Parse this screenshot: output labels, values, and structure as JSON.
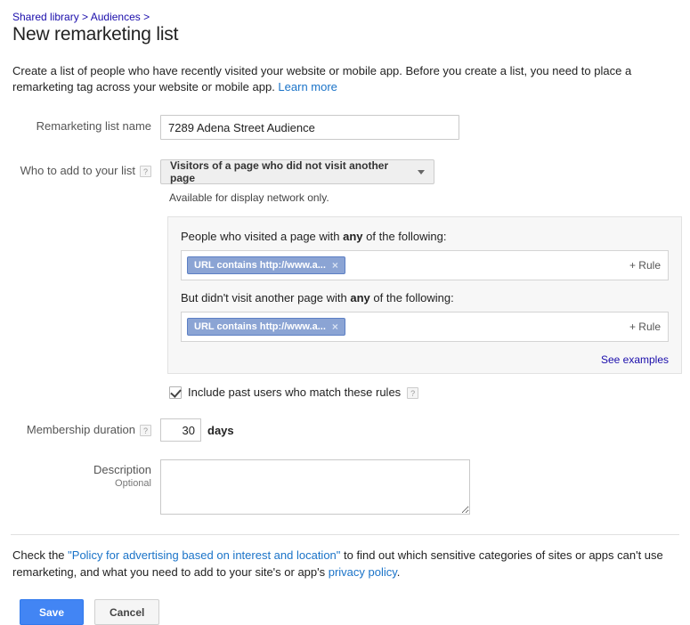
{
  "breadcrumb": {
    "items": [
      "Shared library",
      "Audiences"
    ],
    "separator": ">",
    "trailing_separator": ">"
  },
  "header": {
    "title": "New remarketing list"
  },
  "intro": {
    "text_before_link": "Create a list of people who have recently visited your website or mobile app. Before you create a list, you need to place a remarketing tag across your website or mobile app. ",
    "link_label": "Learn more"
  },
  "form": {
    "list_name": {
      "label": "Remarketing list name",
      "value": "7289 Adena Street Audience",
      "placeholder": ""
    },
    "who_to_add": {
      "label": "Who to add to your list",
      "help": "?",
      "selected": "Visitors of a page who did not visit another page",
      "hint": "Available for display network only."
    },
    "rules": {
      "include_heading_before": "People who visited a page with ",
      "include_heading_bold": "any",
      "include_heading_after": " of the following:",
      "exclude_heading_before": "But didn't visit another page with ",
      "exclude_heading_bold": "any",
      "exclude_heading_after": " of the following:",
      "include_chip": "URL contains http://www.a...",
      "exclude_chip": "URL contains http://www.a...",
      "chip_remove": "×",
      "add_rule_label": "+ Rule",
      "see_examples_label": "See examples"
    },
    "include_past_users": {
      "label": "Include past users who match these rules",
      "checked": true,
      "help": "?"
    },
    "membership_duration": {
      "label": "Membership duration",
      "help": "?",
      "value": "30",
      "unit": "days"
    },
    "description": {
      "label": "Description",
      "sub_label": "Optional",
      "value": "",
      "placeholder": ""
    }
  },
  "policy": {
    "part1": "Check the ",
    "link1": "\"Policy for advertising based on interest and location\"",
    "part2": " to find out which sensitive categories of sites or apps can't use remarketing, and what you need to add to your site's or app's ",
    "link2": "privacy policy",
    "part3": "."
  },
  "footer": {
    "save_label": "Save",
    "cancel_label": "Cancel"
  },
  "colors": {
    "accent_blue": "#4285f4",
    "link_blue": "#1a0dab",
    "chip_blue": "#8ba4d4",
    "panel_gray": "#f7f7f7"
  }
}
